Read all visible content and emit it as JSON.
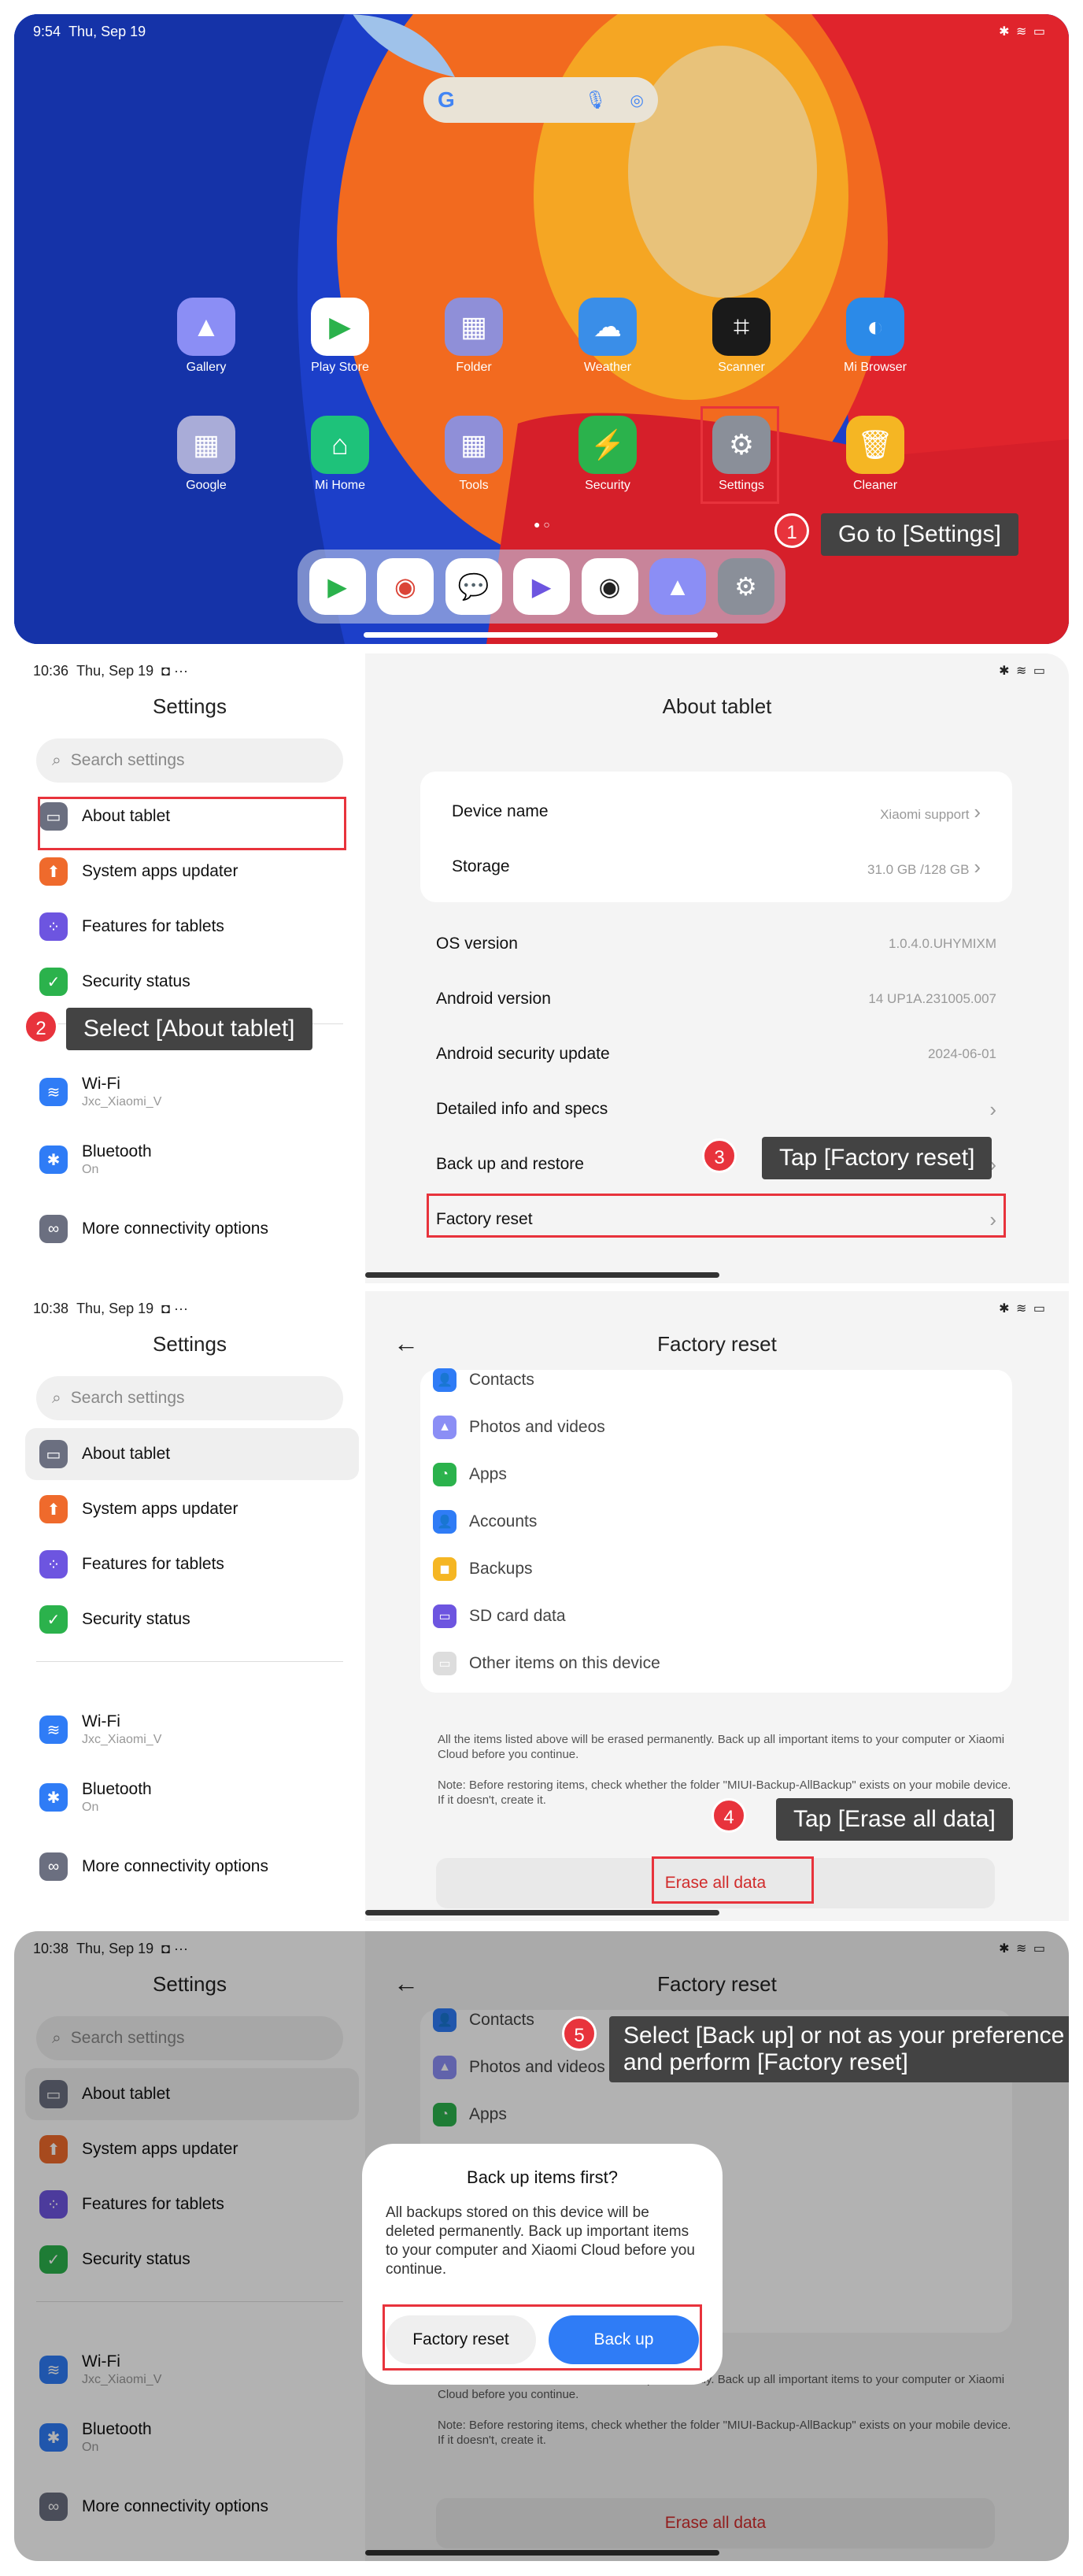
{
  "step1": {
    "status_time": "9:54",
    "status_date": "Thu, Sep 19",
    "status_icons": "✱ ≋ ▭",
    "apps": [
      {
        "label": "Gallery",
        "icon": "gallery-icon",
        "color": "#8b8ef5"
      },
      {
        "label": "Play Store",
        "icon": "play-store-icon",
        "color": "#ffffff"
      },
      {
        "label": "Folder",
        "icon": "folder-icon",
        "color": "#8f8fd8"
      },
      {
        "label": "Weather",
        "icon": "weather-icon",
        "color": "#3a8ee8"
      },
      {
        "label": "Scanner",
        "icon": "scanner-icon",
        "color": "#1a1a1a"
      },
      {
        "label": "Mi Browser",
        "icon": "browser-icon",
        "color": "#2b8ae8"
      },
      {
        "label": "Google",
        "icon": "google-folder-icon",
        "color": "#a9acd8"
      },
      {
        "label": "Mi Home",
        "icon": "mi-home-icon",
        "color": "#1ec27a"
      },
      {
        "label": "Tools",
        "icon": "tools-folder-icon",
        "color": "#8f8fd8"
      },
      {
        "label": "Security",
        "icon": "security-icon",
        "color": "#2bb24c"
      },
      {
        "label": "Settings",
        "icon": "settings-icon",
        "color": "#8a8f99"
      },
      {
        "label": "Cleaner",
        "icon": "cleaner-icon",
        "color": "#f5b623"
      }
    ],
    "callout_num": "1",
    "callout": "Go to [Settings]"
  },
  "settings_left": {
    "title": "Settings",
    "search_placeholder": "Search settings",
    "items": [
      {
        "label": "About tablet",
        "sub": "",
        "color": "#6b6f80"
      },
      {
        "label": "System apps updater",
        "sub": "",
        "color": "#ef6a2c"
      },
      {
        "label": "Features for tablets",
        "sub": "",
        "color": "#6d55e0"
      },
      {
        "label": "Security status",
        "sub": "",
        "color": "#2bb24c"
      },
      {
        "label": "Wi-Fi",
        "sub": "Jxc_Xiaomi_V",
        "color": "#2f7cf6"
      },
      {
        "label": "Bluetooth",
        "sub": "On",
        "color": "#2f7cf6"
      },
      {
        "label": "More connectivity options",
        "sub": "",
        "color": "#6b6f80"
      }
    ]
  },
  "step2": {
    "status_time": "10:36",
    "status_date": "Thu, Sep 19",
    "status_extra": "◘ ···",
    "status_icons": "✱ ≋ ▭",
    "callout_num": "2",
    "callout": "Select [About tablet]"
  },
  "about": {
    "title": "About tablet",
    "device_name_label": "Device name",
    "device_name_value": "Xiaomi support",
    "storage_label": "Storage",
    "storage_value": "31.0 GB /128 GB",
    "os_label": "OS version",
    "os_value": "1.0.4.0.UHYMIXM",
    "android_label": "Android version",
    "android_value": "14 UP1A.231005.007",
    "security_update_label": "Android security update",
    "security_update_value": "2024-06-01",
    "detailed_label": "Detailed info and specs",
    "backup_label": "Back up and restore",
    "factory_label": "Factory reset",
    "callout_num": "3",
    "callout": "Tap [Factory reset]"
  },
  "step3": {
    "status_time": "10:38",
    "status_date": "Thu, Sep 19",
    "status_extra": "◘ ···",
    "status_icons": "✱ ≋ ▭",
    "callout_num": "4",
    "callout": "Tap [Erase all data]"
  },
  "factory": {
    "title": "Factory reset",
    "items": [
      {
        "label": "Contacts",
        "color": "#2f7cf6"
      },
      {
        "label": "Photos and videos",
        "color": "#8b8ef5"
      },
      {
        "label": "Apps",
        "color": "#2bb24c"
      },
      {
        "label": "Accounts",
        "color": "#2f7cf6"
      },
      {
        "label": "Backups",
        "color": "#f5b623"
      },
      {
        "label": "SD card data",
        "color": "#6d55e0"
      },
      {
        "label": "Other items on this device",
        "color": "#dddddd"
      }
    ],
    "note1": "All the items listed above will be erased permanently. Back up all important items to your computer or Xiaomi Cloud before you continue.",
    "note2": "Note: Before restoring items, check whether the folder \"MIUI-Backup-AllBackup\" exists on your mobile device. If it doesn't, create it.",
    "erase_label": "Erase all data"
  },
  "step4": {
    "status_time": "10:38",
    "status_date": "Thu, Sep 19",
    "status_extra": "◘ ···",
    "status_icons": "✱ ≋ ▭",
    "callout_num": "5",
    "callout_line1": "Select [Back up] or not as your preference",
    "callout_line2": "and perform [Factory reset]",
    "dialog_title": "Back up items first?",
    "dialog_body": "All backups stored on this device will be deleted permanently. Back up important items to your computer and Xiaomi Cloud before you continue.",
    "factory_reset_btn": "Factory reset",
    "back_up_btn": "Back up",
    "partial_note1": "All the items listed above will be erased permanently. Back up all important items to your computer or Xiaomi Cloud before you continue."
  }
}
